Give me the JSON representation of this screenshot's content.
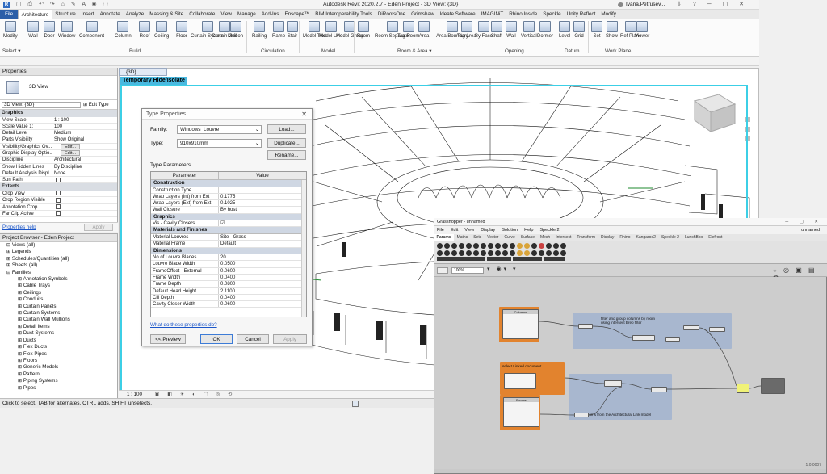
{
  "app": {
    "title": "Autodesk Revit 2020.2.7 - Eden Project - 3D View: {3D}",
    "user": "Ivana.Petrusev..."
  },
  "ribbon_tabs": [
    "File",
    "Architecture",
    "Structure",
    "Insert",
    "Annotate",
    "Analyze",
    "Massing & Site",
    "Collaborate",
    "View",
    "Manage",
    "Add-Ins",
    "Enscape™",
    "BIM Interoperability Tools",
    "DiRootsOne",
    "Grimshaw",
    "Ideate Software",
    "IMAGINiT",
    "Rhino.Inside",
    "Speckle",
    "Unity Reflect",
    "Modify"
  ],
  "ribbon_groups": {
    "select": [
      "Modify"
    ],
    "select_label": "Select ▾",
    "build": [
      "Wall",
      "Door",
      "Window",
      "Component",
      "Column",
      "Roof",
      "Ceiling",
      "Floor",
      "Curtain System",
      "Curtain Grid",
      "Mullion"
    ],
    "build_label": "Build",
    "circulation": [
      "Railing",
      "Ramp",
      "Stair"
    ],
    "circulation_label": "Circulation",
    "model": [
      "Model Text",
      "Model Line",
      "Model Group"
    ],
    "model_label": "Model",
    "room_area": [
      "Room",
      "Room Separator",
      "Tag Room",
      "Area",
      "Area Boundary",
      "Tag Area"
    ],
    "room_area_label": "Room & Area ▾",
    "opening": [
      "By Face",
      "Shaft",
      "Wall",
      "Vertical",
      "Dormer"
    ],
    "opening_label": "Opening",
    "datum": [
      "Level",
      "Grid"
    ],
    "datum_label": "Datum",
    "workplane": [
      "Set",
      "Show",
      "Ref Plane",
      "Viewer"
    ],
    "workplane_label": "Work Plane"
  },
  "properties": {
    "header": "Properties",
    "type_name": "3D View",
    "selector": "3D View: {3D}",
    "edit_type": "Edit Type",
    "sections": [
      {
        "name": "Graphics",
        "rows": [
          {
            "k": "View Scale",
            "v": "1 : 100"
          },
          {
            "k": "Scale Value   1:",
            "v": "100"
          },
          {
            "k": "Detail Level",
            "v": "Medium"
          },
          {
            "k": "Parts Visibility",
            "v": "Show Original"
          },
          {
            "k": "Visibility/Graphics Ov...",
            "v": "Edit..."
          },
          {
            "k": "Graphic Display Optio...",
            "v": "Edit..."
          },
          {
            "k": "Discipline",
            "v": "Architectural"
          },
          {
            "k": "Show Hidden Lines",
            "v": "By Discipline"
          },
          {
            "k": "Default Analysis Displ...",
            "v": "None"
          },
          {
            "k": "Sun Path",
            "v": ""
          }
        ]
      },
      {
        "name": "Extents",
        "rows": [
          {
            "k": "Crop View",
            "v": ""
          },
          {
            "k": "Crop Region Visible",
            "v": ""
          },
          {
            "k": "Annotation Crop",
            "v": ""
          },
          {
            "k": "Far Clip Active",
            "v": ""
          }
        ]
      }
    ],
    "help": "Properties help",
    "apply": "Apply"
  },
  "project_browser": {
    "header": "Project Browser - Eden Project",
    "items": [
      "Views (all)",
      "Legends",
      "Schedules/Quantities (all)",
      "Sheets (all)",
      "Families",
      "Annotation Symbols",
      "Cable Trays",
      "Ceilings",
      "Conduits",
      "Curtain Panels",
      "Curtain Systems",
      "Curtain Wall Mullions",
      "Detail Items",
      "Duct Systems",
      "Ducts",
      "Flex Ducts",
      "Flex Pipes",
      "Floors",
      "Generic Models",
      "Pattern",
      "Piping Systems",
      "Pipes"
    ]
  },
  "view": {
    "tab": "{3D}",
    "temp_label": "Temporary Hide/Isolate",
    "scale": "1 : 100"
  },
  "status": "Click to select, TAB for alternates, CTRL adds, SHIFT unselects.",
  "type_dialog": {
    "title": "Type Properties",
    "family_label": "Family:",
    "family_value": "Windows_Louvre",
    "type_label": "Type:",
    "type_value": "910x910mm",
    "load": "Load...",
    "duplicate": "Duplicate...",
    "rename": "Rename...",
    "params_label": "Type Parameters",
    "col_param": "Parameter",
    "col_value": "Value",
    "sections": [
      {
        "name": "Construction",
        "rows": [
          {
            "p": "Construction Type",
            "v": ""
          },
          {
            "p": "Wrap Layers (Int) from Ext",
            "v": "0.1775"
          },
          {
            "p": "Wrap Layers (Ext) from Ext",
            "v": "0.1025"
          },
          {
            "p": "Wall Closure",
            "v": "By host"
          }
        ]
      },
      {
        "name": "Graphics",
        "rows": [
          {
            "p": "Vis - Cavity Closers",
            "v": "☑"
          }
        ]
      },
      {
        "name": "Materials and Finishes",
        "rows": [
          {
            "p": "Material Louvres",
            "v": "Site - Grass"
          },
          {
            "p": "Material Frame",
            "v": "Default"
          }
        ]
      },
      {
        "name": "Dimensions",
        "rows": [
          {
            "p": "No of Louvre Blades",
            "v": "20"
          },
          {
            "p": "Louvre Blade Width",
            "v": "0.0500"
          },
          {
            "p": "FrameOffset - External",
            "v": "0.0600"
          },
          {
            "p": "Frame Width",
            "v": "0.0400"
          },
          {
            "p": "Frame Depth",
            "v": "0.0800"
          },
          {
            "p": "Default Head Height",
            "v": "2.1100"
          },
          {
            "p": "Cill Depth",
            "v": "0.0400"
          },
          {
            "p": "Cavity Closer Width",
            "v": "0.0600"
          }
        ]
      }
    ],
    "help_link": "What do these properties do?",
    "preview": "<< Preview",
    "ok": "OK",
    "cancel": "Cancel",
    "apply": "Apply"
  },
  "grasshopper": {
    "title": "Grasshopper - unnamed",
    "doc": "unnamed",
    "menu": [
      "File",
      "Edit",
      "View",
      "Display",
      "Solution",
      "Help",
      "Speckle 2"
    ],
    "tabs": [
      "Params",
      "Maths",
      "Sets",
      "Vector",
      "Curve",
      "Surface",
      "Mesh",
      "Intersect",
      "Transform",
      "Display",
      "Rhino",
      "Kangaroo2",
      "Speckle 2",
      "LunchBox",
      "Elefront"
    ],
    "zoom": "100%",
    "groups": {
      "filter_note": "filter and group columns by room using intersect Brep filter",
      "select_note": "select Linked document",
      "fetch_note": "fetch rooms from the Architectural Link model",
      "panel_title": "Columns",
      "rooms_title": "Rooms"
    },
    "version": "1.0.0007"
  }
}
